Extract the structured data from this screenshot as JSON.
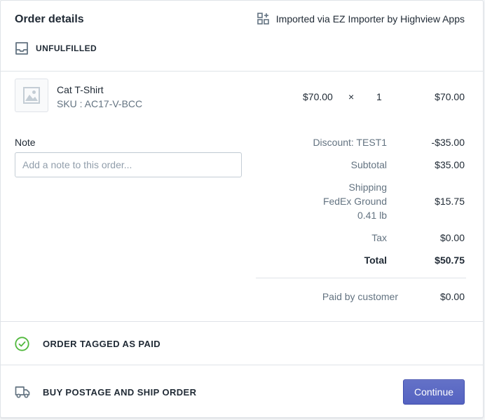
{
  "header": {
    "title": "Order details",
    "import_icon": "apps-icon",
    "imported_text": "Imported via EZ Importer by Highview Apps"
  },
  "fulfillment": {
    "status_icon": "inbox-icon",
    "status_label": "UNFULFILLED"
  },
  "line_item": {
    "thumbnail_icon": "image-placeholder-icon",
    "name": "Cat T-Shirt",
    "sku": "SKU : AC17-V-BCC",
    "price": "$70.00",
    "times": "×",
    "quantity": "1",
    "total": "$70.00"
  },
  "note": {
    "label": "Note",
    "value": "",
    "placeholder": "Add a note to this order..."
  },
  "summary": {
    "discount_label": "Discount: TEST1",
    "discount_value": "-$35.00",
    "subtotal_label": "Subtotal",
    "subtotal_value": "$35.00",
    "shipping_label": "Shipping",
    "shipping_method": "FedEx Ground",
    "shipping_weight": "0.41 lb",
    "shipping_value": "$15.75",
    "tax_label": "Tax",
    "tax_value": "$0.00",
    "total_label": "Total",
    "total_value": "$50.75",
    "paid_label": "Paid by customer",
    "paid_value": "$0.00"
  },
  "payment": {
    "icon": "check-circle-icon",
    "label": "ORDER TAGGED AS PAID"
  },
  "shipping_section": {
    "icon": "truck-icon",
    "label": "BUY POSTAGE AND SHIP ORDER",
    "button_label": "Continue"
  },
  "colors": {
    "primary": "#5c6ac4",
    "success": "#50b83c",
    "text": "#212b36",
    "subdued": "#637381",
    "border": "#dfe3e8"
  }
}
